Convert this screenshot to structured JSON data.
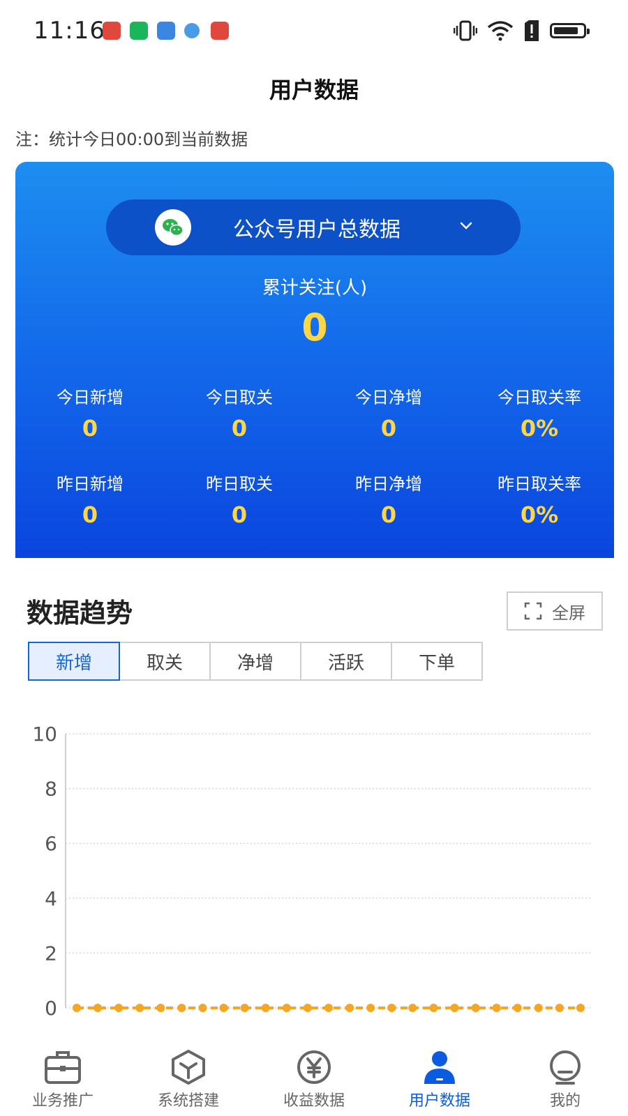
{
  "status_bar": {
    "time": "11:16"
  },
  "page": {
    "title": "用户数据",
    "note": "注：统计今日00:00到当前数据"
  },
  "stats_card": {
    "selector_label": "公众号用户总数据",
    "total_label": "累计关注(人)",
    "total_value": "0",
    "today": [
      {
        "label": "今日新增",
        "value": "0"
      },
      {
        "label": "今日取关",
        "value": "0"
      },
      {
        "label": "今日净增",
        "value": "0"
      },
      {
        "label": "今日取关率",
        "value": "0%"
      }
    ],
    "yesterday": [
      {
        "label": "昨日新增",
        "value": "0"
      },
      {
        "label": "昨日取关",
        "value": "0"
      },
      {
        "label": "昨日净增",
        "value": "0"
      },
      {
        "label": "昨日取关率",
        "value": "0%"
      }
    ]
  },
  "trend": {
    "title": "数据趋势",
    "fullscreen_label": "全屏",
    "tabs": [
      "新增",
      "取关",
      "净增",
      "活跃",
      "下单"
    ],
    "active_tab": 0
  },
  "chart_data": {
    "type": "line",
    "title": "",
    "xlabel": "",
    "ylabel": "",
    "ylim": [
      0,
      10
    ],
    "y_ticks": [
      "0",
      "2",
      "4",
      "6",
      "8",
      "10"
    ],
    "grid": true,
    "series": [
      {
        "values": [
          0,
          0,
          0,
          0,
          0,
          0,
          0,
          0,
          0,
          0,
          0,
          0,
          0,
          0,
          0,
          0,
          0,
          0,
          0,
          0,
          0,
          0,
          0,
          0,
          0
        ]
      }
    ],
    "color": "#f5a623"
  },
  "bottom_nav": {
    "items": [
      {
        "label": "业务推广",
        "icon": "briefcase-icon"
      },
      {
        "label": "系统搭建",
        "icon": "cube-icon"
      },
      {
        "label": "收益数据",
        "icon": "yen-icon"
      },
      {
        "label": "用户数据",
        "icon": "user-icon"
      },
      {
        "label": "我的",
        "icon": "profile-icon"
      }
    ],
    "active": 3,
    "active_color": "#0a5be0",
    "inactive_color": "#666666"
  },
  "colors": {
    "card_gradient_top": "#1d8ef0",
    "card_gradient_bottom": "#0a45de",
    "highlight_value": "#ffd645",
    "accent": "#1565d8"
  }
}
